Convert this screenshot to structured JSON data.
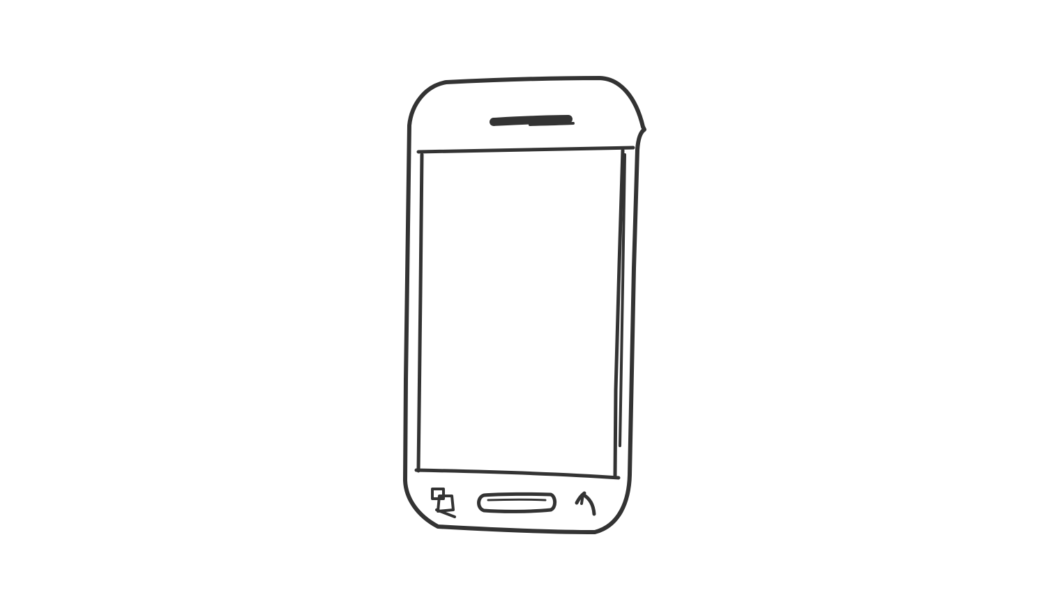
{
  "sketch": {
    "subject": "phone-wireframe",
    "colors": {
      "background": "#ffffff",
      "ink": "#333333"
    },
    "screen": {
      "content": ""
    },
    "nav_bar": {
      "icons": [
        "recent-apps-icon",
        "home-button-icon",
        "back-arrow-icon"
      ]
    }
  }
}
